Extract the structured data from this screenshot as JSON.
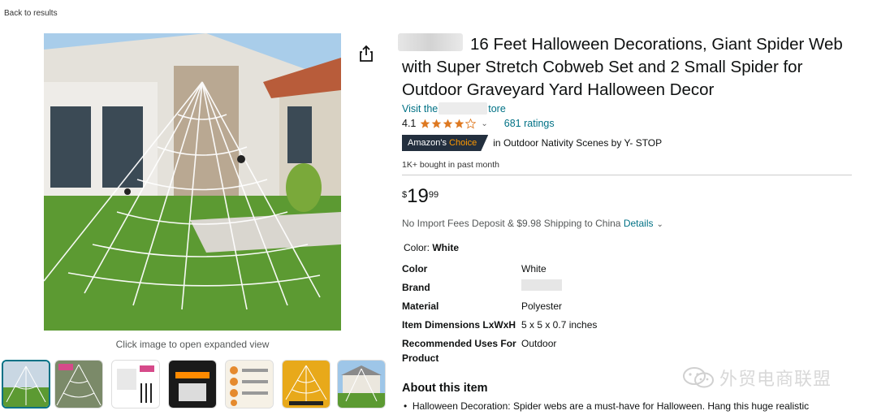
{
  "nav": {
    "back_label": "Back to results"
  },
  "gallery": {
    "caption": "Click image to open expanded view",
    "main_image_icon": "giant-spider-web-house-photo",
    "thumbnails": [
      {
        "icon": "web-house-thumb",
        "selected": true
      },
      {
        "icon": "web-size-thumb",
        "selected": false
      },
      {
        "icon": "package-stakes-thumb",
        "selected": false
      },
      {
        "icon": "super-stretchy-thumb",
        "selected": false
      },
      {
        "icon": "features-list-thumb",
        "selected": false
      },
      {
        "icon": "web-diagram-thumb",
        "selected": false
      },
      {
        "icon": "house-lawn-thumb",
        "selected": false
      }
    ]
  },
  "product": {
    "title": "16 Feet Halloween Decorations, Giant Spider Web with Super Stretch Cobweb Set and 2 Small Spider for Outdoor Graveyard Yard Halloween Decor",
    "store_prefix": "Visit the",
    "store_suffix": "tore",
    "rating_value": "4.1",
    "rating_count_label": "681 ratings",
    "badge_prefix": "Amazon's ",
    "badge_highlight": "Choice",
    "choice_text": "in Outdoor Nativity Scenes by Y- STOP",
    "bought_text": "1K+ bought in past month",
    "price_symbol": "$",
    "price_whole": "19",
    "price_fraction": "99",
    "shipping_text": "No Import Fees Deposit & $9.98 Shipping to China ",
    "details_label": "Details",
    "color_label": "Color: ",
    "color_value": "White"
  },
  "specs": [
    {
      "key": "Color",
      "value": "White"
    },
    {
      "key": "Brand",
      "value": ""
    },
    {
      "key": "Material",
      "value": "Polyester"
    },
    {
      "key": "Item Dimensions LxWxH",
      "value": "5 x 5 x 0.7 inches"
    },
    {
      "key": "Recommended Uses For Product",
      "value": "Outdoor"
    }
  ],
  "about": {
    "heading": "About this item",
    "bullet_1": "Halloween Decoration: Spider webs are a must-have for Halloween. Hang this huge realistic"
  },
  "watermark": {
    "text": "外贸电商联盟",
    "icon": "wechat-icon"
  },
  "colors": {
    "link": "#007185",
    "badge_bg": "#232f3e",
    "badge_accent": "#ff9900",
    "star": "#de7921"
  }
}
